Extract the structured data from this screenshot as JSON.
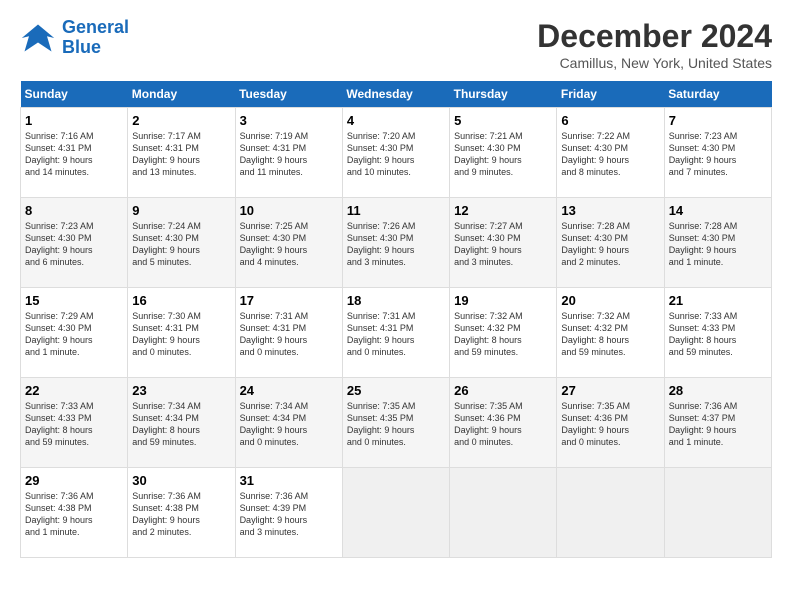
{
  "logo": {
    "line1": "General",
    "line2": "Blue"
  },
  "title": "December 2024",
  "subtitle": "Camillus, New York, United States",
  "days_of_week": [
    "Sunday",
    "Monday",
    "Tuesday",
    "Wednesday",
    "Thursday",
    "Friday",
    "Saturday"
  ],
  "weeks": [
    [
      {
        "day": "1",
        "info": "Sunrise: 7:16 AM\nSunset: 4:31 PM\nDaylight: 9 hours\nand 14 minutes."
      },
      {
        "day": "2",
        "info": "Sunrise: 7:17 AM\nSunset: 4:31 PM\nDaylight: 9 hours\nand 13 minutes."
      },
      {
        "day": "3",
        "info": "Sunrise: 7:19 AM\nSunset: 4:31 PM\nDaylight: 9 hours\nand 11 minutes."
      },
      {
        "day": "4",
        "info": "Sunrise: 7:20 AM\nSunset: 4:30 PM\nDaylight: 9 hours\nand 10 minutes."
      },
      {
        "day": "5",
        "info": "Sunrise: 7:21 AM\nSunset: 4:30 PM\nDaylight: 9 hours\nand 9 minutes."
      },
      {
        "day": "6",
        "info": "Sunrise: 7:22 AM\nSunset: 4:30 PM\nDaylight: 9 hours\nand 8 minutes."
      },
      {
        "day": "7",
        "info": "Sunrise: 7:23 AM\nSunset: 4:30 PM\nDaylight: 9 hours\nand 7 minutes."
      }
    ],
    [
      {
        "day": "8",
        "info": "Sunrise: 7:23 AM\nSunset: 4:30 PM\nDaylight: 9 hours\nand 6 minutes."
      },
      {
        "day": "9",
        "info": "Sunrise: 7:24 AM\nSunset: 4:30 PM\nDaylight: 9 hours\nand 5 minutes."
      },
      {
        "day": "10",
        "info": "Sunrise: 7:25 AM\nSunset: 4:30 PM\nDaylight: 9 hours\nand 4 minutes."
      },
      {
        "day": "11",
        "info": "Sunrise: 7:26 AM\nSunset: 4:30 PM\nDaylight: 9 hours\nand 3 minutes."
      },
      {
        "day": "12",
        "info": "Sunrise: 7:27 AM\nSunset: 4:30 PM\nDaylight: 9 hours\nand 3 minutes."
      },
      {
        "day": "13",
        "info": "Sunrise: 7:28 AM\nSunset: 4:30 PM\nDaylight: 9 hours\nand 2 minutes."
      },
      {
        "day": "14",
        "info": "Sunrise: 7:28 AM\nSunset: 4:30 PM\nDaylight: 9 hours\nand 1 minute."
      }
    ],
    [
      {
        "day": "15",
        "info": "Sunrise: 7:29 AM\nSunset: 4:30 PM\nDaylight: 9 hours\nand 1 minute."
      },
      {
        "day": "16",
        "info": "Sunrise: 7:30 AM\nSunset: 4:31 PM\nDaylight: 9 hours\nand 0 minutes."
      },
      {
        "day": "17",
        "info": "Sunrise: 7:31 AM\nSunset: 4:31 PM\nDaylight: 9 hours\nand 0 minutes."
      },
      {
        "day": "18",
        "info": "Sunrise: 7:31 AM\nSunset: 4:31 PM\nDaylight: 9 hours\nand 0 minutes."
      },
      {
        "day": "19",
        "info": "Sunrise: 7:32 AM\nSunset: 4:32 PM\nDaylight: 8 hours\nand 59 minutes."
      },
      {
        "day": "20",
        "info": "Sunrise: 7:32 AM\nSunset: 4:32 PM\nDaylight: 8 hours\nand 59 minutes."
      },
      {
        "day": "21",
        "info": "Sunrise: 7:33 AM\nSunset: 4:33 PM\nDaylight: 8 hours\nand 59 minutes."
      }
    ],
    [
      {
        "day": "22",
        "info": "Sunrise: 7:33 AM\nSunset: 4:33 PM\nDaylight: 8 hours\nand 59 minutes."
      },
      {
        "day": "23",
        "info": "Sunrise: 7:34 AM\nSunset: 4:34 PM\nDaylight: 8 hours\nand 59 minutes."
      },
      {
        "day": "24",
        "info": "Sunrise: 7:34 AM\nSunset: 4:34 PM\nDaylight: 9 hours\nand 0 minutes."
      },
      {
        "day": "25",
        "info": "Sunrise: 7:35 AM\nSunset: 4:35 PM\nDaylight: 9 hours\nand 0 minutes."
      },
      {
        "day": "26",
        "info": "Sunrise: 7:35 AM\nSunset: 4:36 PM\nDaylight: 9 hours\nand 0 minutes."
      },
      {
        "day": "27",
        "info": "Sunrise: 7:35 AM\nSunset: 4:36 PM\nDaylight: 9 hours\nand 0 minutes."
      },
      {
        "day": "28",
        "info": "Sunrise: 7:36 AM\nSunset: 4:37 PM\nDaylight: 9 hours\nand 1 minute."
      }
    ],
    [
      {
        "day": "29",
        "info": "Sunrise: 7:36 AM\nSunset: 4:38 PM\nDaylight: 9 hours\nand 1 minute."
      },
      {
        "day": "30",
        "info": "Sunrise: 7:36 AM\nSunset: 4:38 PM\nDaylight: 9 hours\nand 2 minutes."
      },
      {
        "day": "31",
        "info": "Sunrise: 7:36 AM\nSunset: 4:39 PM\nDaylight: 9 hours\nand 3 minutes."
      },
      {
        "day": "",
        "info": ""
      },
      {
        "day": "",
        "info": ""
      },
      {
        "day": "",
        "info": ""
      },
      {
        "day": "",
        "info": ""
      }
    ]
  ]
}
